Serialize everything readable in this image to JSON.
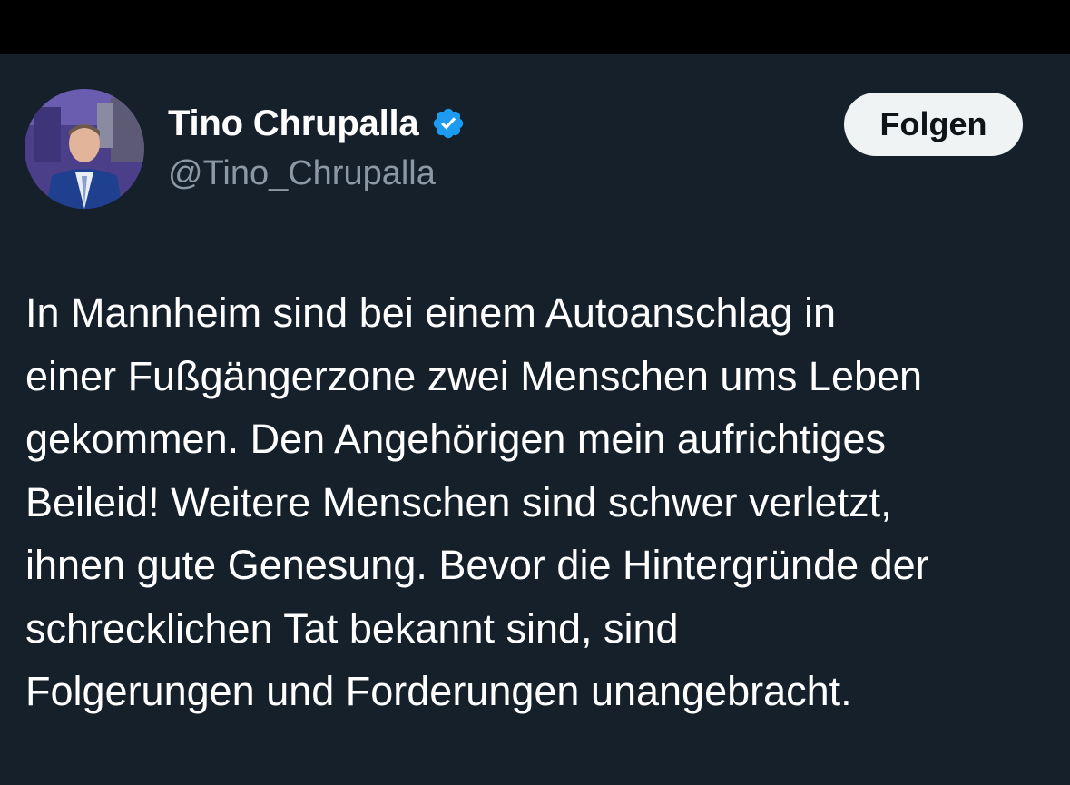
{
  "author": {
    "display_name": "Tino Chrupalla",
    "handle": "@Tino_Chrupalla",
    "verified": true,
    "verified_icon": "verified-badge-icon",
    "avatar": "profile-photo"
  },
  "actions": {
    "follow_label": "Folgen"
  },
  "tweet": {
    "lines": [
      "In Mannheim sind bei einem Autoanschlag in",
      "einer Fußgängerzone zwei Menschen ums Leben",
      "gekommen. Den Angehörigen mein aufrichtiges",
      "Beileid! Weitere Menschen sind schwer verletzt,",
      "ihnen gute Genesung. Bevor die Hintergründe der",
      "schrecklichen Tat bekannt sind, sind",
      "Folgerungen und Forderungen unangebracht."
    ]
  },
  "colors": {
    "background": "#15202b",
    "top_bar": "#000000",
    "text": "#ffffff",
    "handle": "#8b98a5",
    "verified": "#1d9bf0",
    "button_bg": "#eff3f4",
    "button_text": "#0f1419"
  }
}
